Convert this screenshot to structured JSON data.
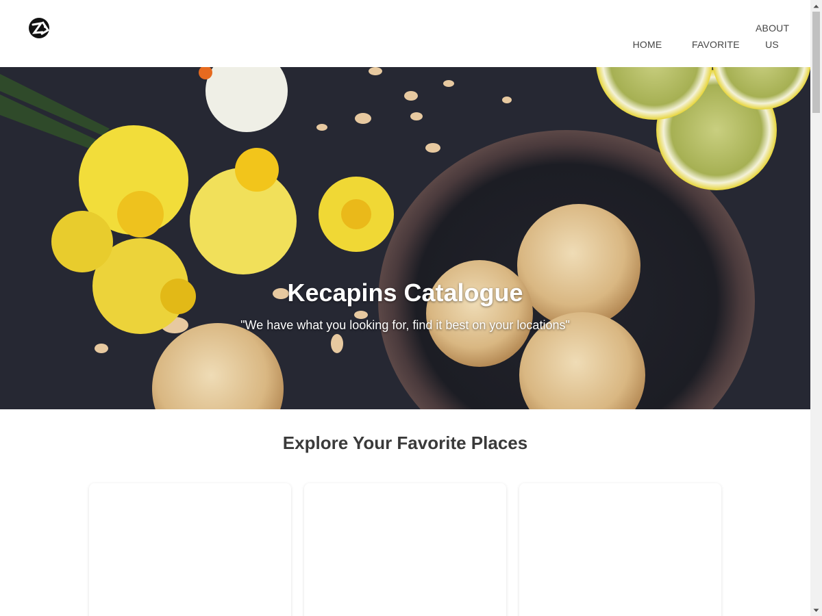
{
  "header": {
    "logo_icon": "logo-icon",
    "nav": {
      "home": "HOME",
      "favorite": "FAVORITE",
      "about": "ABOUT US"
    }
  },
  "hero": {
    "title": "Kecapins Catalogue",
    "subtitle": "\"We have what you looking for, find it best on your locations\""
  },
  "main": {
    "section_title": "Explore Your Favorite Places"
  },
  "colors": {
    "hero_background": "#23252e",
    "title_text": "#3a3a3a",
    "nav_text": "#444444"
  }
}
